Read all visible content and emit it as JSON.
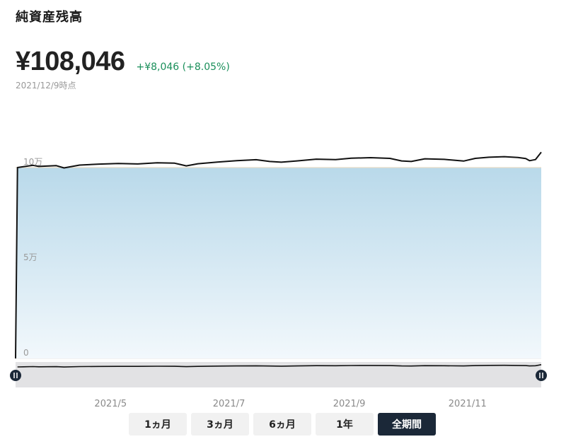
{
  "header": {
    "title": "純資産残高",
    "net_value": "¥108,046",
    "change": "+¥8,046 (+8.05%)",
    "as_of": "2021/12/9時点"
  },
  "colors": {
    "line": "#111111",
    "area_top": "#b9d9ea",
    "area_bottom": "#f2f8fc",
    "change_positive": "#1a8f5a",
    "active_button": "#1b2838"
  },
  "period_buttons": [
    {
      "label": "1ヵ月",
      "active": false
    },
    {
      "label": "3ヵ月",
      "active": false
    },
    {
      "label": "6ヵ月",
      "active": false
    },
    {
      "label": "1年",
      "active": false
    },
    {
      "label": "全期間",
      "active": true
    }
  ],
  "chart_data": {
    "type": "area",
    "title": "",
    "xlabel": "",
    "ylabel": "",
    "ylim": [
      0,
      100000
    ],
    "y_ticks": [
      {
        "value": 0,
        "label": "0"
      },
      {
        "value": 50000,
        "label": "5万"
      },
      {
        "value": 100000,
        "label": "10万"
      }
    ],
    "x_ticks": [
      {
        "date": "2021-05-01",
        "label": "2021/5"
      },
      {
        "date": "2021-07-01",
        "label": "2021/7"
      },
      {
        "date": "2021-09-01",
        "label": "2021/9"
      },
      {
        "date": "2021-11-01",
        "label": "2021/11"
      }
    ],
    "x_range": [
      "2021-03-13",
      "2021-12-09"
    ],
    "grid": true,
    "series": [
      {
        "values": [
          {
            "date": "2021-03-13",
            "value": 0
          },
          {
            "date": "2021-03-14",
            "value": 100000
          },
          {
            "date": "2021-03-17",
            "value": 100500
          },
          {
            "date": "2021-03-22",
            "value": 101200
          },
          {
            "date": "2021-03-25",
            "value": 100600
          },
          {
            "date": "2021-04-03",
            "value": 101000
          },
          {
            "date": "2021-04-07",
            "value": 99800
          },
          {
            "date": "2021-04-15",
            "value": 101300
          },
          {
            "date": "2021-04-25",
            "value": 101800
          },
          {
            "date": "2021-05-05",
            "value": 102100
          },
          {
            "date": "2021-05-15",
            "value": 101900
          },
          {
            "date": "2021-05-25",
            "value": 102500
          },
          {
            "date": "2021-06-03",
            "value": 102300
          },
          {
            "date": "2021-06-09",
            "value": 100900
          },
          {
            "date": "2021-06-15",
            "value": 102000
          },
          {
            "date": "2021-06-25",
            "value": 102900
          },
          {
            "date": "2021-07-05",
            "value": 103600
          },
          {
            "date": "2021-07-15",
            "value": 104100
          },
          {
            "date": "2021-07-22",
            "value": 103200
          },
          {
            "date": "2021-07-28",
            "value": 102800
          },
          {
            "date": "2021-08-05",
            "value": 103500
          },
          {
            "date": "2021-08-15",
            "value": 104400
          },
          {
            "date": "2021-08-25",
            "value": 104200
          },
          {
            "date": "2021-09-02",
            "value": 104900
          },
          {
            "date": "2021-09-12",
            "value": 105200
          },
          {
            "date": "2021-09-22",
            "value": 104800
          },
          {
            "date": "2021-09-28",
            "value": 103500
          },
          {
            "date": "2021-10-03",
            "value": 103200
          },
          {
            "date": "2021-10-10",
            "value": 104600
          },
          {
            "date": "2021-10-20",
            "value": 104300
          },
          {
            "date": "2021-10-30",
            "value": 103400
          },
          {
            "date": "2021-11-05",
            "value": 104800
          },
          {
            "date": "2021-11-12",
            "value": 105400
          },
          {
            "date": "2021-11-20",
            "value": 105700
          },
          {
            "date": "2021-11-27",
            "value": 105300
          },
          {
            "date": "2021-12-01",
            "value": 104700
          },
          {
            "date": "2021-12-03",
            "value": 103600
          },
          {
            "date": "2021-12-06",
            "value": 104200
          },
          {
            "date": "2021-12-09",
            "value": 108046
          }
        ]
      }
    ]
  }
}
